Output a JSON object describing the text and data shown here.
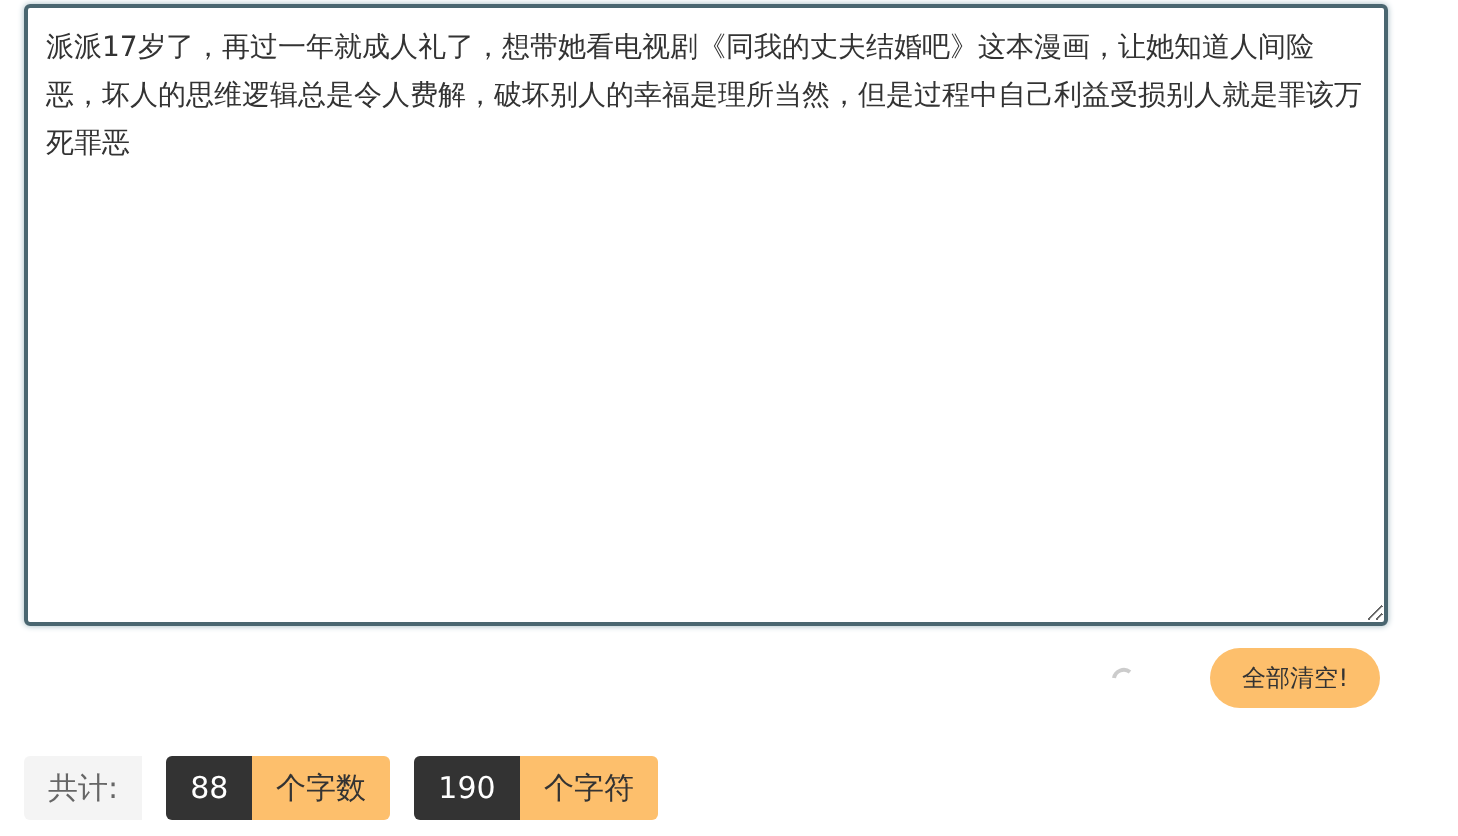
{
  "editor": {
    "value": "派派17岁了，再过一年就成人礼了，想带她看电视剧《同我的丈夫结婚吧》这本漫画，让她知道人间险恶，坏人的思维逻辑总是令人费解，破坏别人的幸福是理所当然，但是过程中自己利益受损别人就是罪该万死罪恶"
  },
  "clear_button": {
    "label": "全部清空!"
  },
  "stats": {
    "label": "共计:",
    "items": [
      {
        "value": "88",
        "unit": "个字数"
      },
      {
        "value": "190",
        "unit": "个字符"
      }
    ]
  }
}
